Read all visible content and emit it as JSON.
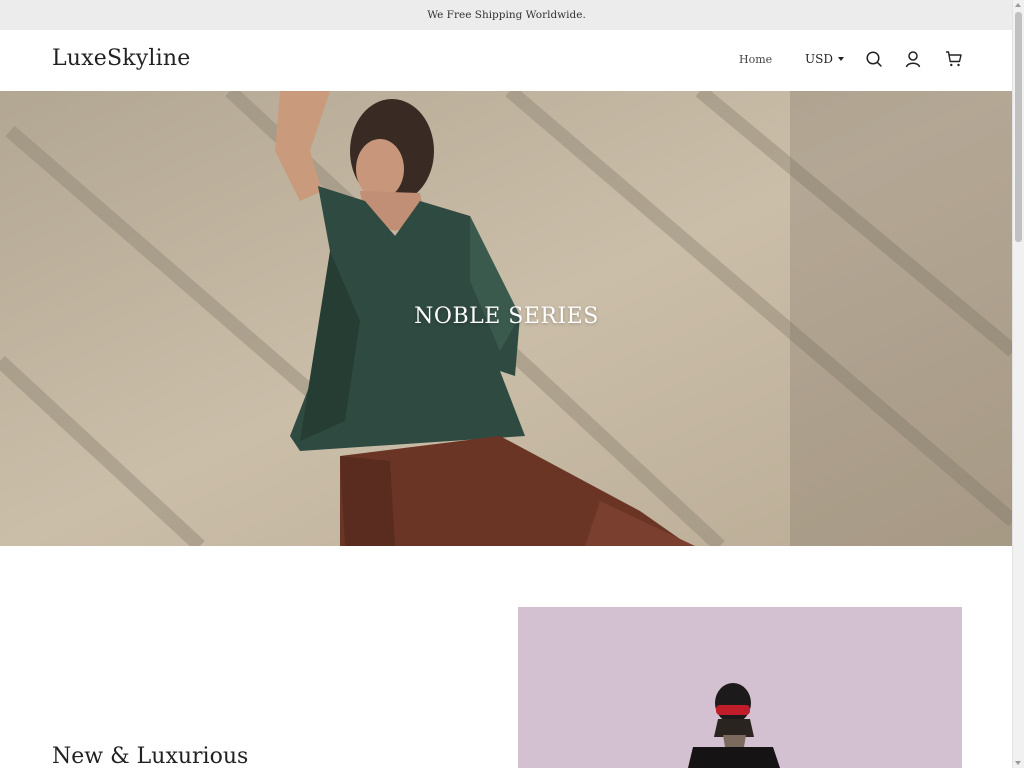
{
  "announcement": {
    "text": "We Free Shipping Worldwide."
  },
  "header": {
    "logo": "LuxeSkyline",
    "nav": {
      "home": "Home"
    },
    "currency": {
      "selected": "USD"
    },
    "icons": [
      "search-icon",
      "account-icon",
      "cart-icon"
    ]
  },
  "hero": {
    "title": "NOBLE SERIES"
  },
  "section": {
    "heading": "New & Luxurious"
  },
  "colors": {
    "announcement_bg": "#ececec",
    "hero_wall": "#c8bca8",
    "shirt_green": "#2f4a40",
    "pants_brown": "#6b3526",
    "promo_bg": "#d8c6d6"
  }
}
